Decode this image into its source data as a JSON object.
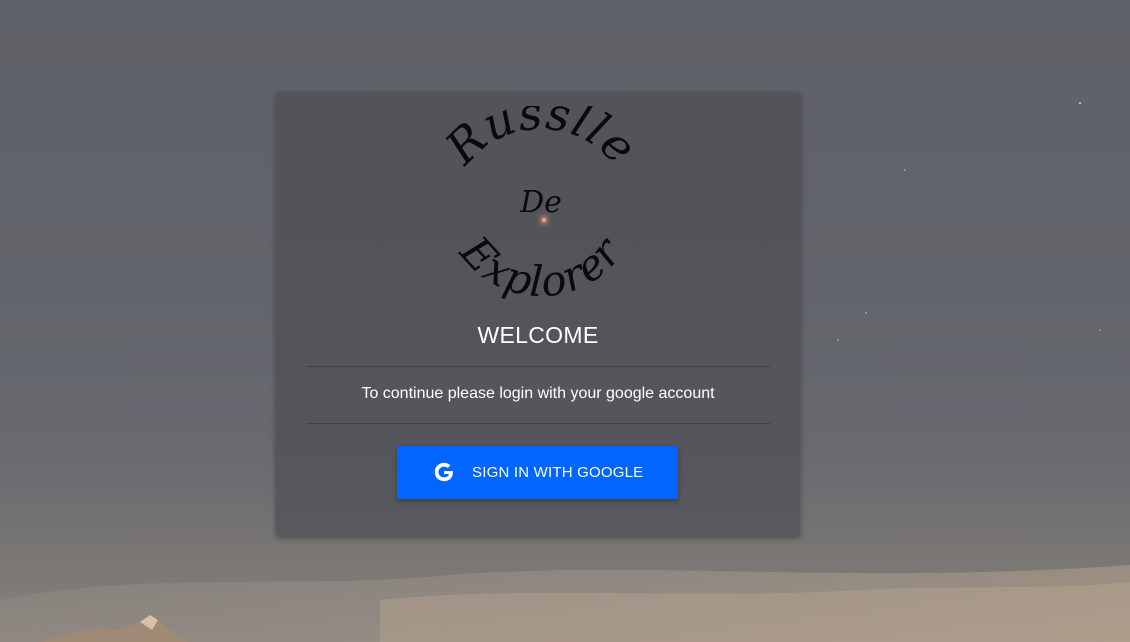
{
  "brand": {
    "logo_top_text": "Russlle",
    "logo_center_text": "De",
    "logo_bottom_text": "Explorer"
  },
  "login": {
    "title": "WELCOME",
    "subtitle": "To continue please login with your google account",
    "google_button_label": "SIGN IN WITH GOOGLE",
    "google_button_icon": "google-g-icon"
  },
  "colors": {
    "button_bg": "#0066ff",
    "card_bg": "rgba(78,79,85,0.72)",
    "text": "#ffffff"
  }
}
